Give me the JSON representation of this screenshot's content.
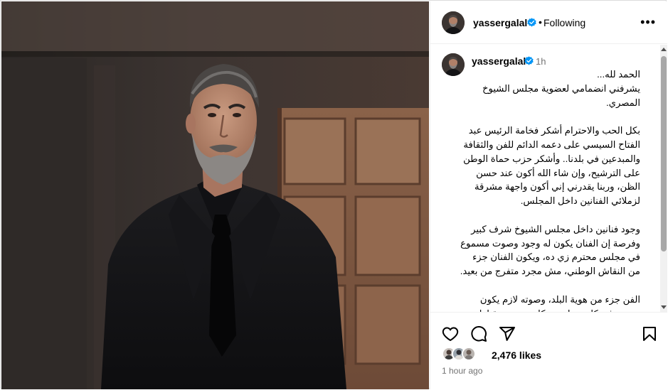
{
  "post": {
    "image_alt": "",
    "username": "yassergalal",
    "verified": true,
    "follow_state": "Following",
    "more_icon": "more-horizontal-icon"
  },
  "caption": {
    "username": "yassergalal",
    "time": "1h",
    "text": "الحمد لله...\nيشرفني انضمامي لعضوية مجلس الشيوخ المصري.\n\nبكل الحب والاحترام أشكر فخامة الرئيس عبد الفتاح السيسي على دعمه الدائم للفن والثقافة والمبدعين في بلدنا.. وأشكر حزب حماة الوطن على الترشيح، وإن شاء الله أكون عند حسن الظن، وربنا يقدرني إني أكون واجهة مشرقة لزملائي الفنانين داخل المجلس.\n\nوجود فنانين داخل مجلس الشيوخ شرف كبير وفرصة إن الفنان يكون له وجود وصوت مسموع في مجلس محترم زي ده، ويكون الفنان جزء من النقاش الوطني، مش مجرد متفرج من بعيد.\n\nالفن جزء من هوية البلد، وصوته لازم يكون موجود في كل مساحة بتتكلم عن مستقبلها.\nو أدعو الله سبحانه وتعالى أن أكون إضافة حقيقية، وأن أنجح في تمثيل الفنانين والمبدعين بالشكل اللي يليق بمكانتهم وبقيمة الفن المصري."
  },
  "actions": {
    "like_icon": "heart-icon",
    "comment_icon": "comment-icon",
    "share_icon": "share-icon",
    "save_icon": "bookmark-icon"
  },
  "engagement": {
    "likes": "2,476 likes",
    "posted_ago": "1 hour ago"
  },
  "colors": {
    "verified_blue": "#0095f6",
    "secondary_text": "#737373",
    "border": "#dbdbdb"
  }
}
